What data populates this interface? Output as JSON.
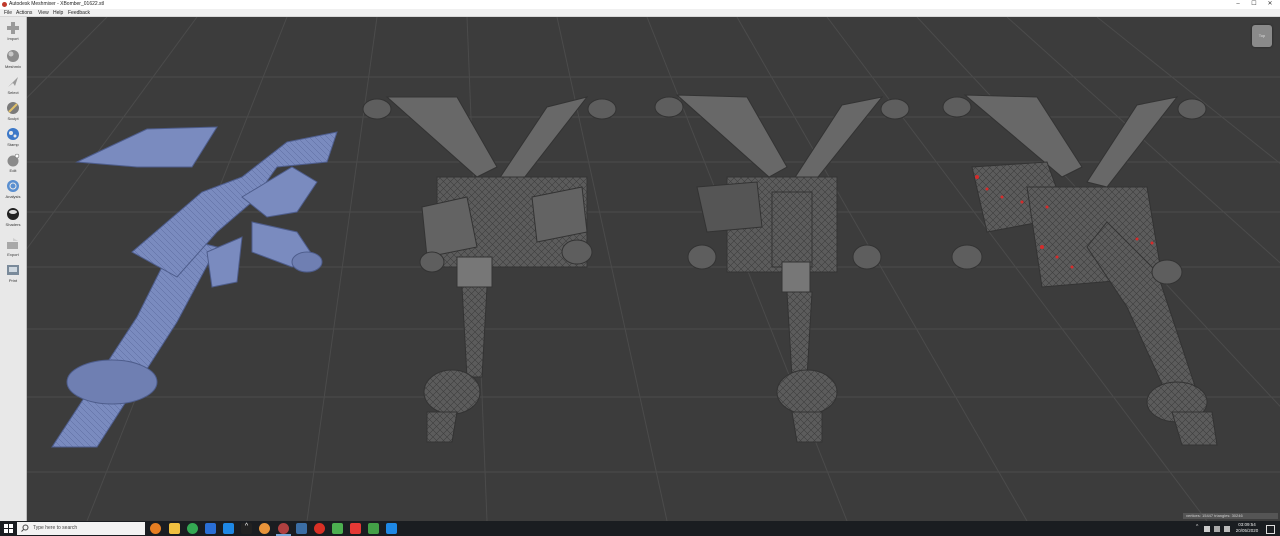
{
  "window": {
    "title": "Autodesk Meshmixer - XBomber_01622.stl",
    "controls": [
      "–",
      "☐",
      "✕"
    ]
  },
  "menu": {
    "items": [
      "File",
      "Actions",
      "View",
      "Help",
      "Feedback"
    ]
  },
  "toolbar": {
    "tools": [
      {
        "label": "Import",
        "icon": "plus-icon"
      },
      {
        "label": "Meshmix",
        "icon": "meshmix-sphere-icon"
      },
      {
        "label": "Select",
        "icon": "select-arrow-icon"
      },
      {
        "label": "Sculpt",
        "icon": "sculpt-brush-icon"
      },
      {
        "label": "Stamp",
        "icon": "stamp-globe-icon"
      },
      {
        "label": "Edit",
        "icon": "edit-sphere-icon"
      },
      {
        "label": "Analysis",
        "icon": "analysis-sphere-icon"
      },
      {
        "label": "Shaders",
        "icon": "shaders-sphere-icon"
      },
      {
        "label": "Export",
        "icon": "export-box-icon"
      },
      {
        "label": "Print",
        "icon": "print-icon"
      }
    ]
  },
  "viewport": {
    "viewcube_label": "Top",
    "status_text": "vertices: 15447 triangles: 30246",
    "colors": {
      "background": "#3c3c3c",
      "grid": "#4b4b4b",
      "selected_mesh": "#7a8bbf",
      "mesh": "#6b6b6b",
      "error_marker": "#d62b2b"
    }
  },
  "taskbar": {
    "search_placeholder": "Type here to search",
    "apps": [
      "blender-icon",
      "file-explorer-icon",
      "chrome-icon",
      "app-icon",
      "app-icon",
      "terminal-icon",
      "app-icon",
      "meshmixer-icon",
      "app-icon",
      "app-icon",
      "app-icon",
      "app-icon",
      "app-icon",
      "app-icon"
    ],
    "time": "03:09:54",
    "date": "20/05/2020"
  }
}
